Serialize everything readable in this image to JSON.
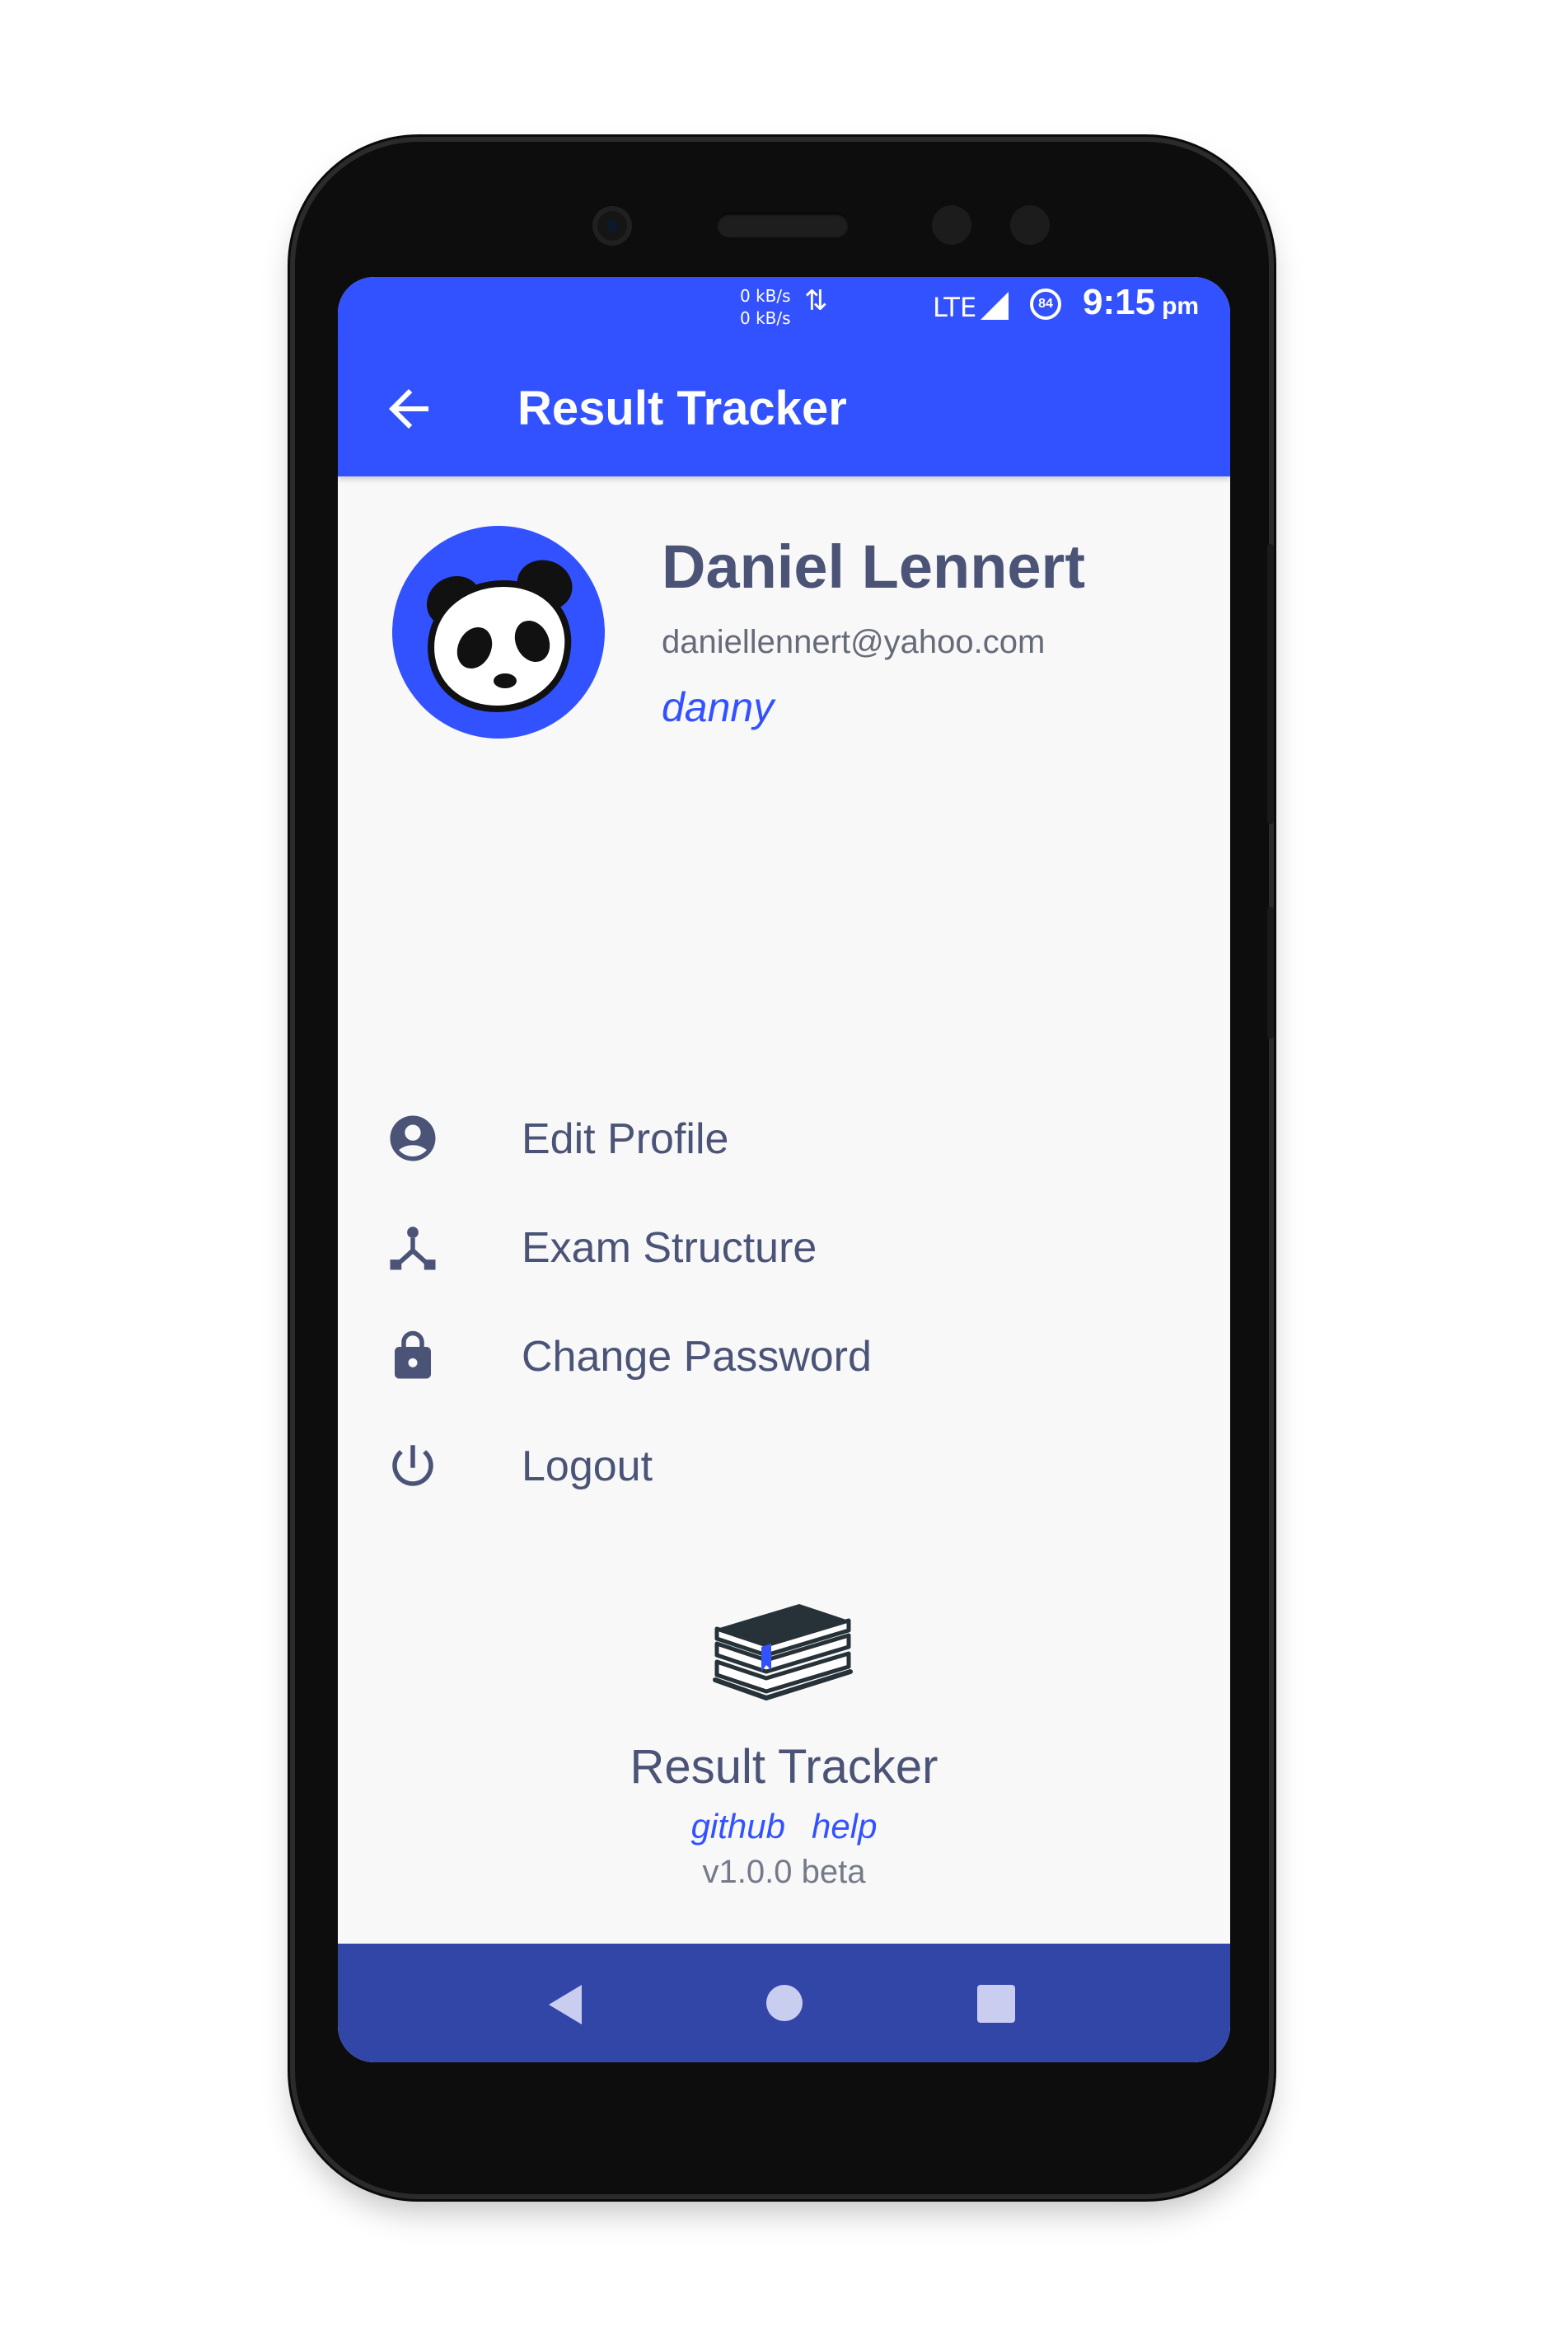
{
  "status_bar": {
    "net_up": "0 kB/s",
    "net_down": "0 kB/s",
    "network": "LTE",
    "battery": "84",
    "time": "9:15",
    "ampm": "pm"
  },
  "app_bar": {
    "title": "Result Tracker"
  },
  "profile": {
    "name": "Daniel Lennert",
    "email": "daniellennert@yahoo.com",
    "username": "danny"
  },
  "menu": {
    "items": [
      {
        "label": "Edit Profile",
        "icon": "account-circle-icon"
      },
      {
        "label": "Exam Structure",
        "icon": "structure-icon"
      },
      {
        "label": "Change Password",
        "icon": "lock-icon"
      },
      {
        "label": "Logout",
        "icon": "power-icon"
      }
    ]
  },
  "footer": {
    "app_name": "Result Tracker",
    "links": [
      "github",
      "help"
    ],
    "version": "v1.0.0 beta"
  },
  "colors": {
    "primary": "#3352ff",
    "nav_bar": "#3246a8",
    "text": "#4b5477",
    "background": "#f8f8f8"
  }
}
